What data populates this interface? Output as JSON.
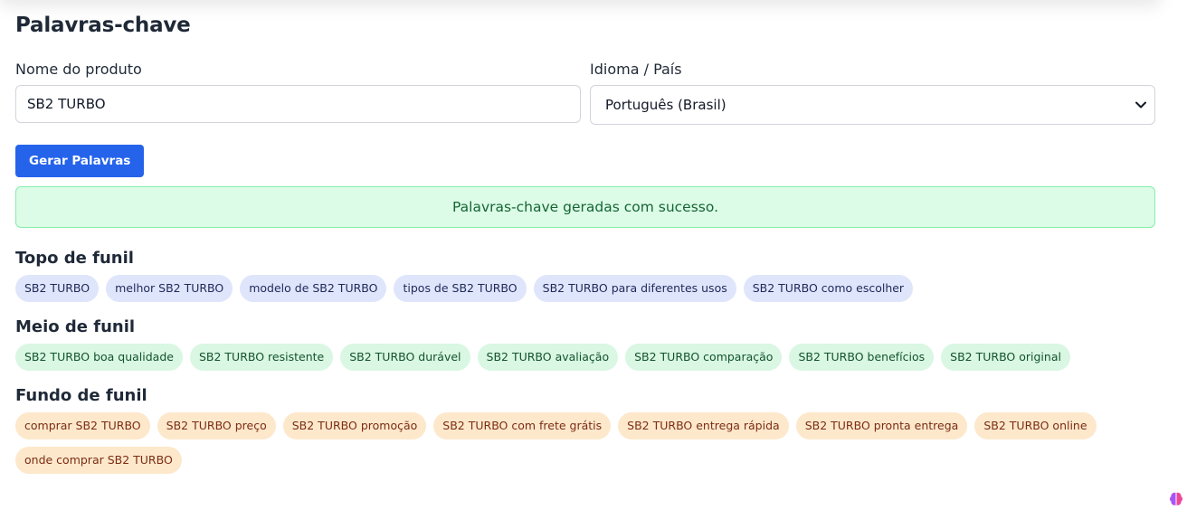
{
  "page": {
    "title": "Palavras-chave"
  },
  "form": {
    "product_label": "Nome do produto",
    "product_value": "SB2 TURBO",
    "language_label": "Idioma / País",
    "language_value": "Português (Brasil)",
    "generate_label": "Gerar Palavras"
  },
  "alert": {
    "message": "Palavras-chave geradas com sucesso."
  },
  "sections": {
    "top": {
      "title": "Topo de funil",
      "keywords": [
        "SB2 TURBO",
        "melhor SB2 TURBO",
        "modelo de SB2 TURBO",
        "tipos de SB2 TURBO",
        "SB2 TURBO para diferentes usos",
        "SB2 TURBO como escolher"
      ]
    },
    "middle": {
      "title": "Meio de funil",
      "keywords": [
        "SB2 TURBO boa qualidade",
        "SB2 TURBO resistente",
        "SB2 TURBO durável",
        "SB2 TURBO avaliação",
        "SB2 TURBO comparação",
        "SB2 TURBO benefícios",
        "SB2 TURBO original"
      ]
    },
    "bottom": {
      "title": "Fundo de funil",
      "keywords": [
        "comprar SB2 TURBO",
        "SB2 TURBO preço",
        "SB2 TURBO promoção",
        "SB2 TURBO com frete grátis",
        "SB2 TURBO entrega rápida",
        "SB2 TURBO pronta entrega",
        "SB2 TURBO online",
        "onde comprar SB2 TURBO"
      ]
    }
  },
  "icons": {
    "select_arrow": "chevron-down-icon",
    "corner": "brain-icon"
  },
  "colors": {
    "primary": "#2563eb",
    "success_bg": "#dcfce7",
    "success_text": "#166534",
    "top_chip": "#dfe5fb",
    "middle_chip": "#d9f7e3",
    "bottom_chip": "#fde8cc"
  }
}
